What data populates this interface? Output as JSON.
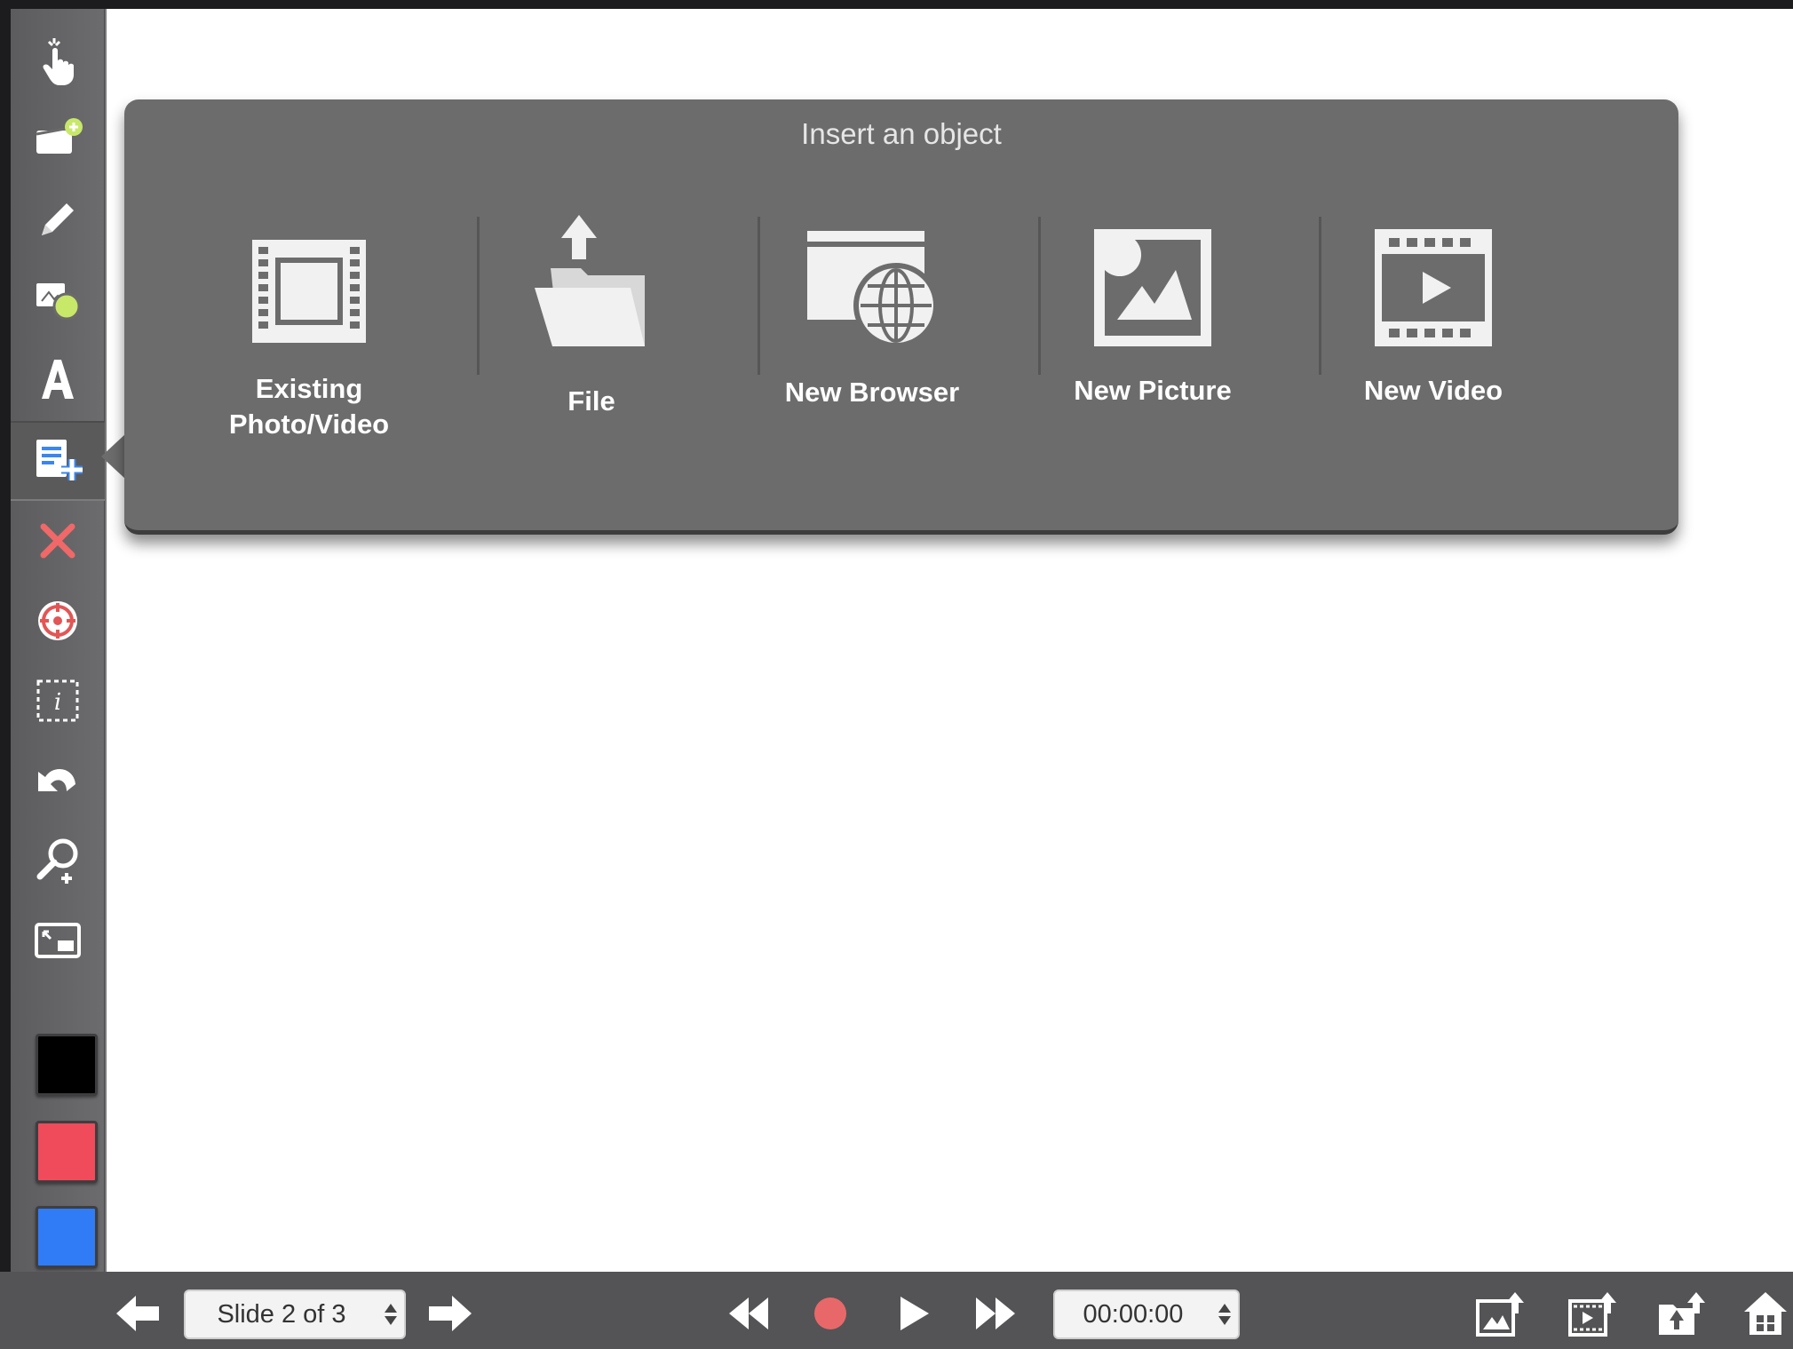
{
  "popover": {
    "title": "Insert an object",
    "options": [
      {
        "label": "Existing\nPhoto/Video",
        "icon": "film-strip-icon"
      },
      {
        "label": "File",
        "icon": "folder-upload-icon"
      },
      {
        "label": "New Browser",
        "icon": "browser-globe-icon"
      },
      {
        "label": "New Picture",
        "icon": "picture-icon"
      },
      {
        "label": "New Video",
        "icon": "video-icon"
      }
    ]
  },
  "sidebar": {
    "tools": [
      "pointer-hand-icon",
      "add-slide-icon",
      "pencil-icon",
      "shapes-icon",
      "text-icon",
      "insert-object-icon",
      "delete-icon",
      "target-icon",
      "info-box-icon",
      "undo-icon",
      "zoom-in-icon",
      "fit-screen-icon"
    ],
    "active_tool": "insert-object-icon",
    "colors": [
      "#000000",
      "#ef4b5a",
      "#2f7cf6"
    ]
  },
  "bottombar": {
    "slide_indicator": "Slide 2 of 3",
    "time": "00:00:00",
    "record_color": "#e8686a"
  }
}
